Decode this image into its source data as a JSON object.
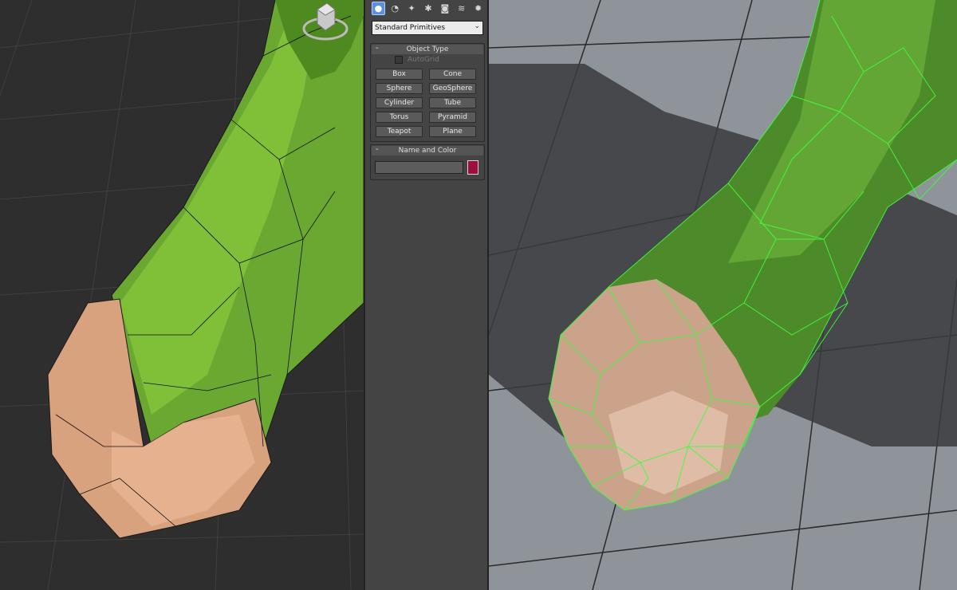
{
  "command_panel": {
    "tabs": [
      {
        "icon": "sphere-icon",
        "glyph": "●",
        "active": true
      },
      {
        "icon": "shapes-icon",
        "glyph": "◔"
      },
      {
        "icon": "lights-icon",
        "glyph": "✦"
      },
      {
        "icon": "cameras-icon",
        "glyph": "✱"
      },
      {
        "icon": "helpers-icon",
        "glyph": "◙"
      },
      {
        "icon": "spacewarps-icon",
        "glyph": "≋"
      },
      {
        "icon": "systems-icon",
        "glyph": "✹"
      }
    ],
    "category_dropdown": {
      "value": "Standard Primitives"
    },
    "object_type": {
      "title": "Object Type",
      "toggle": "-",
      "autogrid_label": "AutoGrid",
      "autogrid_checked": false,
      "buttons": [
        "Box",
        "Cone",
        "Sphere",
        "GeoSphere",
        "Cylinder",
        "Tube",
        "Torus",
        "Pyramid",
        "Teapot",
        "Plane"
      ]
    },
    "name_and_color": {
      "title": "Name and Color",
      "toggle": "-",
      "name_value": "",
      "swatch_color": "#a00c3f"
    }
  },
  "viewports": {
    "left": {
      "background": "#2e2e2e",
      "mesh_color": "#6aa832"
    },
    "right": {
      "background": "#8f949b",
      "wire_color": "#3cff3c"
    }
  }
}
